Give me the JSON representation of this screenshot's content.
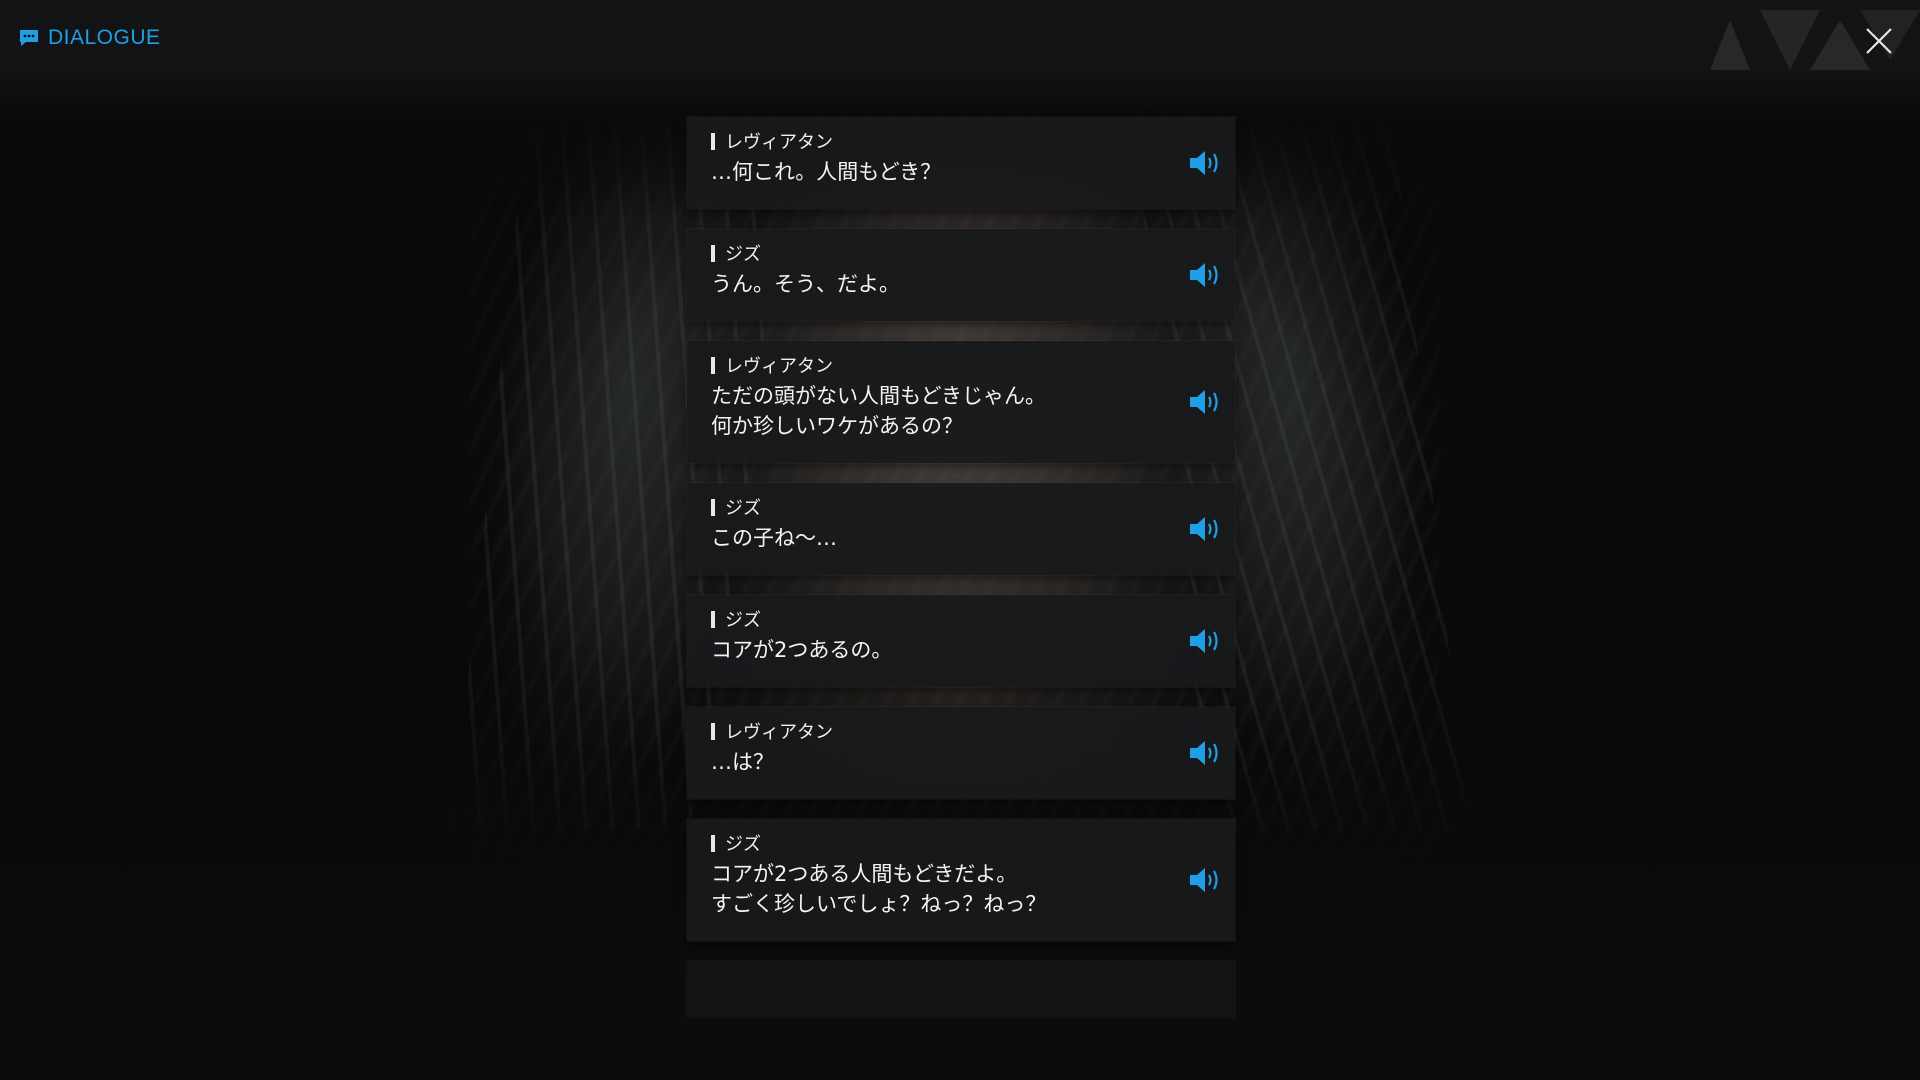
{
  "header": {
    "title": "DIALOGUE",
    "icon": "chat-bubble-icon",
    "close_icon": "close-icon"
  },
  "colors": {
    "accent": "#1fa0e6",
    "card_bg": "#18191b",
    "text": "#f4f4f4"
  },
  "dialogue": [
    {
      "speaker": "レヴィアタン",
      "text": "…何これ。人間もどき？",
      "voice_icon": "speaker-icon"
    },
    {
      "speaker": "ジズ",
      "text": "うん。そう、だよ。",
      "voice_icon": "speaker-icon"
    },
    {
      "speaker": "レヴィアタン",
      "text": "ただの頭がない人間もどきじゃん。\n何か珍しいワケがあるの？",
      "voice_icon": "speaker-icon"
    },
    {
      "speaker": "ジズ",
      "text": "この子ね～…",
      "voice_icon": "speaker-icon"
    },
    {
      "speaker": "ジズ",
      "text": "コアが2つあるの。",
      "voice_icon": "speaker-icon"
    },
    {
      "speaker": "レヴィアタン",
      "text": "…は？",
      "voice_icon": "speaker-icon"
    },
    {
      "speaker": "ジズ",
      "text": "コアが2つある人間もどきだよ。\nすごく珍しいでしょ？ねっ？ねっ？",
      "voice_icon": "speaker-icon"
    }
  ]
}
